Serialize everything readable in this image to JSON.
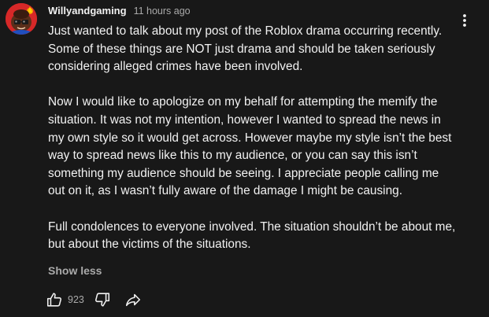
{
  "comment": {
    "author": "Willyandgaming",
    "timestamp": "11 hours ago",
    "paragraphs": [
      "Just wanted to talk about my post of the Roblox drama occurring recently. Some of these things are NOT just drama and should be taken seriously  considering alleged crimes have been involved.",
      "Now I would like to apologize on my behalf for attempting the memify the situation. It was not my intention, however I wanted to spread the news in my own style so it would get across. However maybe my style isn’t the best way to spread news like this to my audience, or you can say this isn’t something my audience should be seeing. I appreciate people calling me out on it, as I wasn’t fully aware of the damage I might be causing.",
      "Full condolences to everyone involved. The situation shouldn’t be about me, but about the victims of the situations."
    ],
    "show_less_label": "Show less",
    "like_count": "923",
    "icons": {
      "avatar": "avatar-image",
      "menu": "more-vert-icon",
      "like": "thumbs-up-icon",
      "dislike": "thumbs-down-icon",
      "share": "share-icon"
    }
  },
  "colors": {
    "background": "#181818",
    "text_primary": "#f1f1f1",
    "text_secondary": "#aaaaaa",
    "avatar_bg": "#d62828"
  }
}
